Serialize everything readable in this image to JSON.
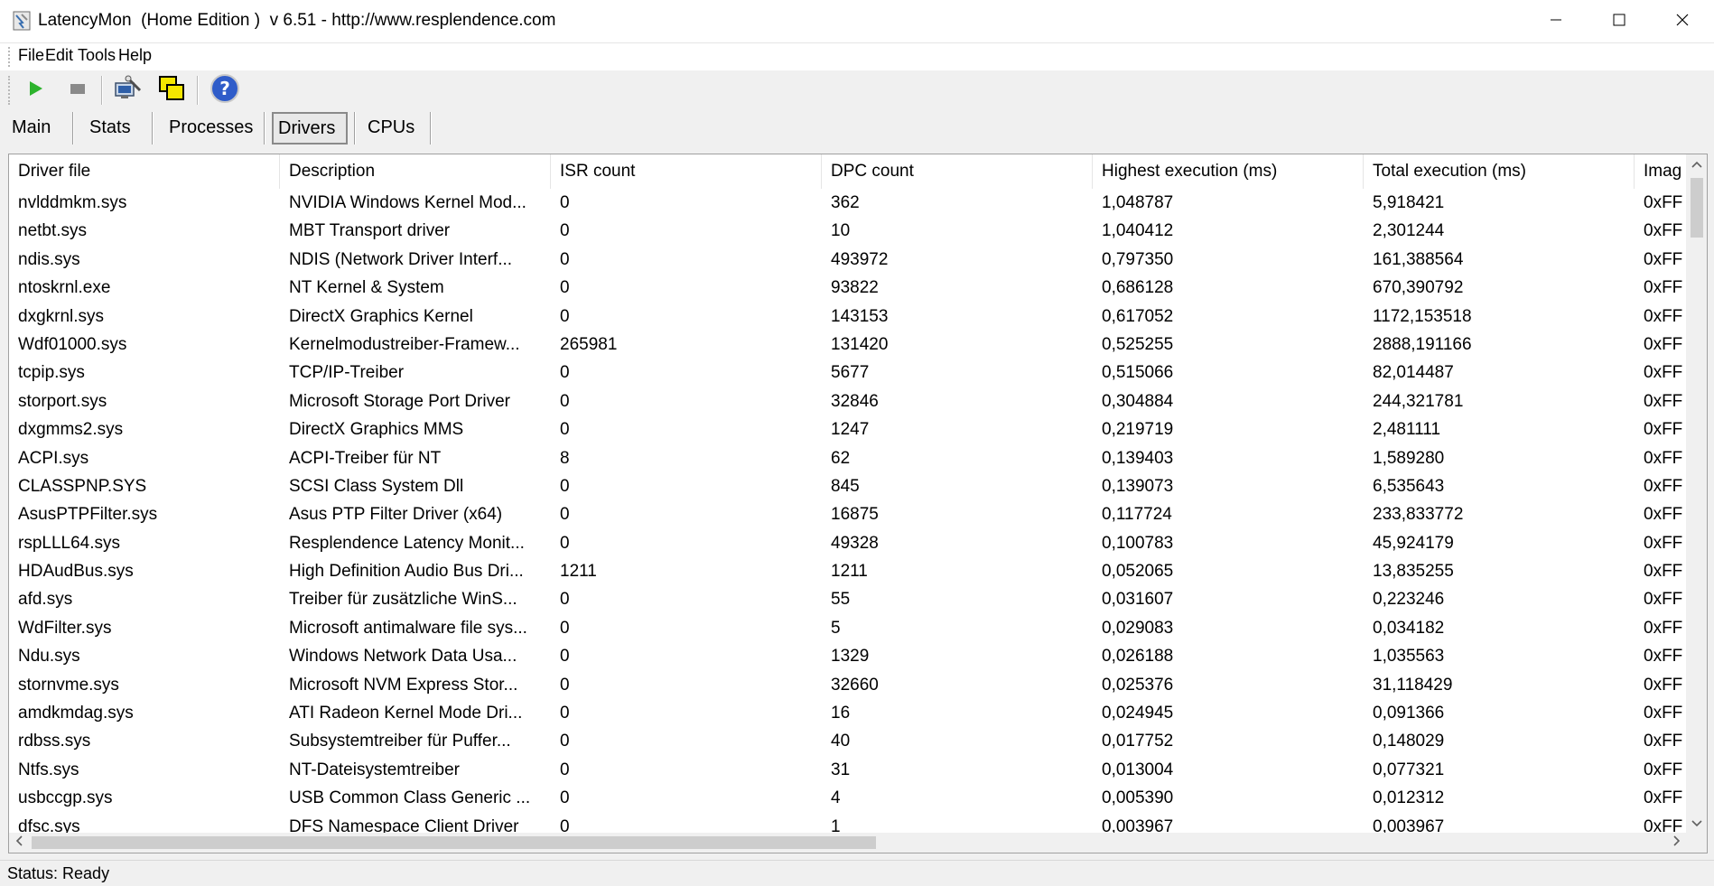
{
  "window": {
    "title": "LatencyMon  (Home Edition )  v 6.51 - http://www.resplendence.com",
    "app_icon": "latencymon-icon",
    "controls": [
      "minimize-icon",
      "maximize-icon",
      "close-icon"
    ]
  },
  "menu": {
    "items": [
      "File",
      "Edit",
      "Tools",
      "Help"
    ]
  },
  "toolbar": {
    "buttons": [
      {
        "name": "start-monitoring",
        "icon": "play-icon",
        "color": "#2db32d"
      },
      {
        "name": "stop-monitoring",
        "icon": "stop-icon",
        "color": "#8a8a8a"
      },
      {
        "name": "analyze",
        "icon": "computer-wizard-icon"
      },
      {
        "name": "windows",
        "icon": "windows-stack-icon",
        "color": "#f5e600"
      },
      {
        "name": "help",
        "icon": "help-icon",
        "color": "#2f5cc9"
      }
    ]
  },
  "tabs": {
    "items": [
      "Main",
      "Stats",
      "Processes",
      "Drivers",
      "CPUs"
    ],
    "active": "Drivers"
  },
  "table": {
    "columns": [
      "Driver file",
      "Description",
      "ISR count",
      "DPC count",
      "Highest execution (ms)",
      "Total execution (ms)",
      "Imag"
    ],
    "rows": [
      [
        "nvlddmkm.sys",
        "NVIDIA Windows Kernel Mod...",
        "0",
        "362",
        "1,048787",
        "5,918421",
        "0xFF"
      ],
      [
        "netbt.sys",
        "MBT Transport driver",
        "0",
        "10",
        "1,040412",
        "2,301244",
        "0xFF"
      ],
      [
        "ndis.sys",
        "NDIS (Network Driver Interf...",
        "0",
        "493972",
        "0,797350",
        "161,388564",
        "0xFF"
      ],
      [
        "ntoskrnl.exe",
        "NT Kernel & System",
        "0",
        "93822",
        "0,686128",
        "670,390792",
        "0xFF"
      ],
      [
        "dxgkrnl.sys",
        "DirectX Graphics Kernel",
        "0",
        "143153",
        "0,617052",
        "1172,153518",
        "0xFF"
      ],
      [
        "Wdf01000.sys",
        "Kernelmodustreiber-Framew...",
        "265981",
        "131420",
        "0,525255",
        "2888,191166",
        "0xFF"
      ],
      [
        "tcpip.sys",
        "TCP/IP-Treiber",
        "0",
        "5677",
        "0,515066",
        "82,014487",
        "0xFF"
      ],
      [
        "storport.sys",
        "Microsoft Storage Port Driver",
        "0",
        "32846",
        "0,304884",
        "244,321781",
        "0xFF"
      ],
      [
        "dxgmms2.sys",
        "DirectX Graphics MMS",
        "0",
        "1247",
        "0,219719",
        "2,481111",
        "0xFF"
      ],
      [
        "ACPI.sys",
        "ACPI-Treiber für NT",
        "8",
        "62",
        "0,139403",
        "1,589280",
        "0xFF"
      ],
      [
        "CLASSPNP.SYS",
        "SCSI Class System Dll",
        "0",
        "845",
        "0,139073",
        "6,535643",
        "0xFF"
      ],
      [
        "AsusPTPFilter.sys",
        "Asus PTP Filter Driver (x64)",
        "0",
        "16875",
        "0,117724",
        "233,833772",
        "0xFF"
      ],
      [
        "rspLLL64.sys",
        "Resplendence Latency Monit...",
        "0",
        "49328",
        "0,100783",
        "45,924179",
        "0xFF"
      ],
      [
        "HDAudBus.sys",
        "High Definition Audio Bus Dri...",
        "1211",
        "1211",
        "0,052065",
        "13,835255",
        "0xFF"
      ],
      [
        "afd.sys",
        "Treiber für zusätzliche WinS...",
        "0",
        "55",
        "0,031607",
        "0,223246",
        "0xFF"
      ],
      [
        "WdFilter.sys",
        "Microsoft antimalware file sys...",
        "0",
        "5",
        "0,029083",
        "0,034182",
        "0xFF"
      ],
      [
        "Ndu.sys",
        "Windows Network Data Usa...",
        "0",
        "1329",
        "0,026188",
        "1,035563",
        "0xFF"
      ],
      [
        "stornvme.sys",
        "Microsoft NVM Express Stor...",
        "0",
        "32660",
        "0,025376",
        "31,118429",
        "0xFF"
      ],
      [
        "amdkmdag.sys",
        "ATI Radeon Kernel Mode Dri...",
        "0",
        "16",
        "0,024945",
        "0,091366",
        "0xFF"
      ],
      [
        "rdbss.sys",
        "Subsystemtreiber für Puffer...",
        "0",
        "40",
        "0,017752",
        "0,148029",
        "0xFF"
      ],
      [
        "Ntfs.sys",
        "NT-Dateisystemtreiber",
        "0",
        "31",
        "0,013004",
        "0,077321",
        "0xFF"
      ],
      [
        "usbccgp.sys",
        "USB Common Class Generic ...",
        "0",
        "4",
        "0,005390",
        "0,012312",
        "0xFF"
      ],
      [
        "dfsc.sys",
        "DFS Namespace Client Driver",
        "0",
        "1",
        "0,003967",
        "0,003967",
        "0xFF"
      ]
    ]
  },
  "status": {
    "text": "Status: Ready"
  }
}
